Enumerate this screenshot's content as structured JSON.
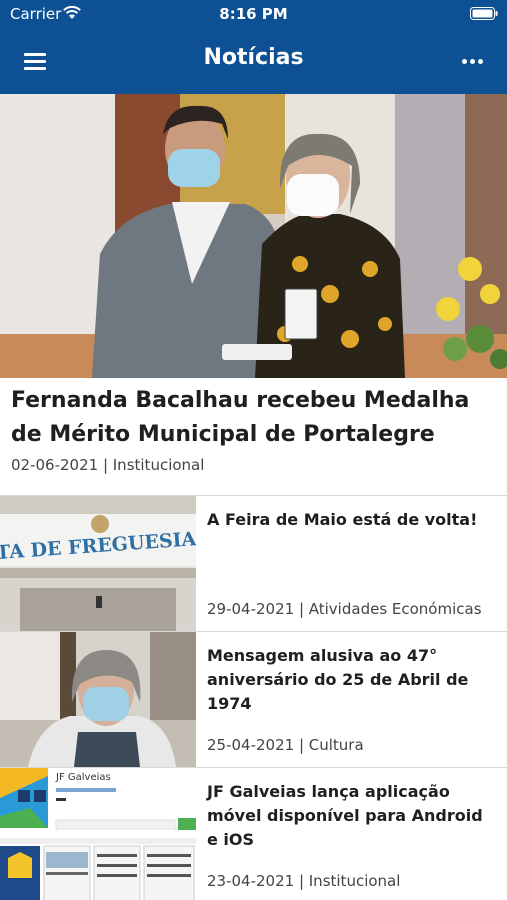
{
  "status_bar": {
    "carrier": "Carrier",
    "time": "8:16 PM"
  },
  "navbar": {
    "title": "Notícias",
    "menu_icon": "hamburger-menu-icon",
    "more_icon": "more-horizontal-icon"
  },
  "colors": {
    "header_bg": "#0d5194",
    "header_text": "#ffffff",
    "title_text": "#1f1f1f",
    "meta_text": "#444444",
    "divider": "#d8d8d8"
  },
  "featured": {
    "title": "Fernanda Bacalhau recebeu Medalha de Mérito Municipal de Portalegre",
    "meta": "02-06-2021 | Institucional"
  },
  "news": [
    {
      "title": "A Feira de Maio está de volta!",
      "meta": "29-04-2021 | Atividades Económicas",
      "thumb_text": "TA DE FREGUESIA DE GALVE"
    },
    {
      "title": "Mensagem alusiva ao 47° aniversário do 25 de Abril de 1974",
      "meta": "25-04-2021 | Cultura"
    },
    {
      "title": "JF Galveias lança aplicação móvel disponível para Android e iOS",
      "meta": "23-04-2021 | Institucional",
      "thumb_text": "JF Galveias"
    }
  ]
}
